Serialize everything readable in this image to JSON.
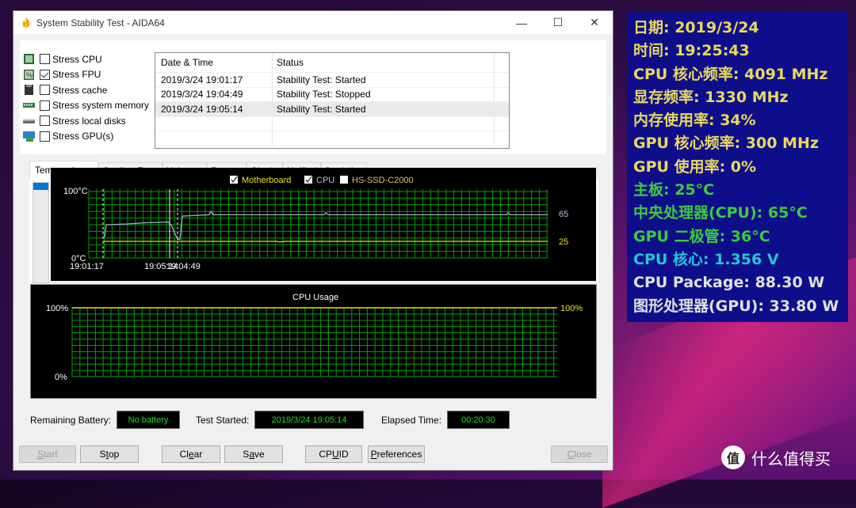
{
  "window": {
    "title": "System Stability Test - AIDA64",
    "controls": {
      "minimize": "—",
      "maximize": "☐",
      "close": "✕"
    }
  },
  "stress_options": [
    {
      "label": "Stress CPU",
      "checked": false,
      "icon": "cpu-chip-icon"
    },
    {
      "label": "Stress FPU",
      "checked": true,
      "icon": "fpu-chip-icon"
    },
    {
      "label": "Stress cache",
      "checked": false,
      "icon": "cache-icon"
    },
    {
      "label": "Stress system memory",
      "checked": false,
      "icon": "memory-icon"
    },
    {
      "label": "Stress local disks",
      "checked": false,
      "icon": "disk-icon"
    },
    {
      "label": "Stress GPU(s)",
      "checked": false,
      "icon": "gpu-icon"
    }
  ],
  "log": {
    "headers": [
      "Date & Time",
      "Status"
    ],
    "rows": [
      {
        "time": "2019/3/24 19:01:17",
        "status": "Stability Test: Started"
      },
      {
        "time": "2019/3/24 19:04:49",
        "status": "Stability Test: Stopped"
      },
      {
        "time": "2019/3/24 19:05:14",
        "status": "Stability Test: Started"
      }
    ],
    "selected_index": 2
  },
  "tabs": [
    {
      "label": "Temperatures",
      "active": true
    },
    {
      "label": "Cooling Fans",
      "active": false
    },
    {
      "label": "Voltages",
      "active": false
    },
    {
      "label": "Powers",
      "active": false
    },
    {
      "label": "Clocks",
      "active": false
    },
    {
      "label": "Unified",
      "active": false
    },
    {
      "label": "Statistics",
      "active": false
    }
  ],
  "temp_chart": {
    "legend": [
      {
        "label": "Motherboard",
        "checked": true,
        "color": "#e8e800"
      },
      {
        "label": "CPU",
        "checked": true,
        "color": "#b0c4de"
      },
      {
        "label": "HS-SSD-C2000",
        "checked": false,
        "color": "#e8c070"
      }
    ],
    "y_max_label": "100°C",
    "y_min_label": "0°C",
    "x_labels": [
      "19:01:17",
      "19:05:14",
      "19:04:49"
    ],
    "current_values": {
      "cpu": "65",
      "motherboard": "25"
    },
    "colors": {
      "grid": "#00a000",
      "cpu": "#9fb4c8",
      "motherboard": "#e8e800",
      "marker": "#ffffff",
      "value_cpu": "#b0c4de",
      "value_mb": "#e8e800"
    }
  },
  "usage_chart": {
    "title": "CPU Usage",
    "y_max_label": "100%",
    "y_min_label": "0%",
    "current_value": "100%",
    "value": 100
  },
  "status": {
    "battery_label": "Remaining Battery:",
    "battery_value": "No battery",
    "started_label": "Test Started:",
    "started_value": "2019/3/24 19:05:14",
    "elapsed_label": "Elapsed Time:",
    "elapsed_value": "00:20:30"
  },
  "buttons": {
    "start": {
      "label": "Start",
      "ul": "S",
      "rest": "tart",
      "enabled": false
    },
    "stop": {
      "label": "Stop",
      "pre": "S",
      "ul": "t",
      "rest": "op",
      "enabled": true
    },
    "clear": {
      "label": "Clear",
      "pre": "Cl",
      "ul": "e",
      "rest": "ar",
      "enabled": true
    },
    "save": {
      "label": "Save",
      "pre": "S",
      "ul": "a",
      "rest": "ve",
      "enabled": true
    },
    "cpuid": {
      "label": "CPUID",
      "pre": "CP",
      "ul": "U",
      "rest": "ID",
      "enabled": true
    },
    "preferences": {
      "label": "Preferences",
      "ul": "P",
      "rest": "references",
      "enabled": true
    },
    "close": {
      "label": "Close",
      "ul": "C",
      "rest": "lose",
      "enabled": false
    }
  },
  "osd": {
    "lines": [
      {
        "text": "日期: 2019/3/24",
        "color": "#e8d860"
      },
      {
        "text": "时间: 19:25:43",
        "color": "#e8d860"
      },
      {
        "text": "CPU 核心频率: 4091 MHz",
        "color": "#e8d860"
      },
      {
        "text": "显存频率: 1330 MHz",
        "color": "#e8d860"
      },
      {
        "text": "内存使用率: 34%",
        "color": "#e8d860"
      },
      {
        "text": "GPU 核心频率: 300 MHz",
        "color": "#e8d860"
      },
      {
        "text": "GPU 使用率: 0%",
        "color": "#e8d860"
      },
      {
        "text": "主板: 25°C",
        "color": "#3ccc3c"
      },
      {
        "text": "中央处理器(CPU): 65°C",
        "color": "#3ccc3c"
      },
      {
        "text": "GPU 二极管: 36°C",
        "color": "#3ccc3c"
      },
      {
        "text": "CPU 核心: 1.356 V",
        "color": "#20c8d8"
      },
      {
        "text": "CPU Package: 88.30 W",
        "color": "#e0e0e0"
      },
      {
        "text": "图形处理器(GPU): 33.80 W",
        "color": "#e0e0e0"
      }
    ]
  },
  "watermark": {
    "badge": "值",
    "text": "什么值得买"
  }
}
